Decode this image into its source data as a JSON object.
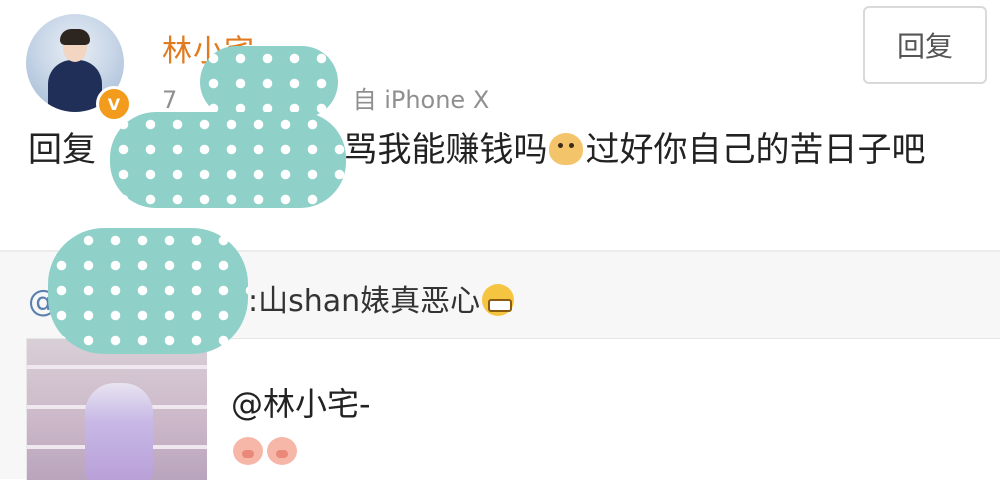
{
  "reply": {
    "username": "林小宅-",
    "verified_badge": "V",
    "meta_prefix": "7",
    "meta_source": "自 iPhone X",
    "reply_button_label": "回复",
    "text_prefix": "回复",
    "text_suffix": ":骂我能赚钱吗",
    "text_tail": "过好你自己的苦日子吧"
  },
  "original": {
    "at_symbol": "@",
    "text": ":山shan婊真恶心",
    "card_name": "@林小宅-"
  },
  "icons": {
    "avatar": "avatar-photo",
    "verified": "verified-v-icon",
    "doge": "doge-emoji-icon",
    "grin": "grin-emoji-icon",
    "pig": "pig-emoji-icon"
  },
  "colors": {
    "username": "#e07b1f",
    "badge": "#f29b1d",
    "mask": "#8fd0c9",
    "background_original": "#f7f7f7"
  }
}
